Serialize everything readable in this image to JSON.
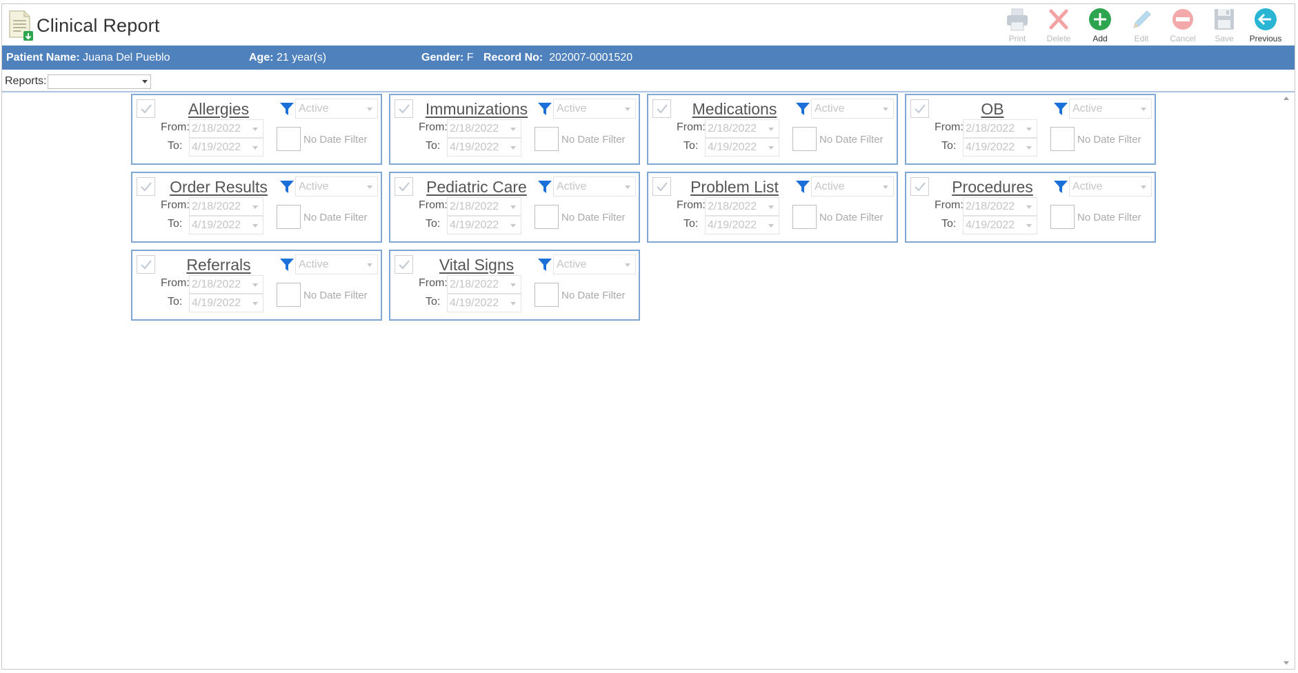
{
  "header": {
    "title": "Clinical Report",
    "toolbar": [
      {
        "key": "print",
        "label": "Print",
        "enabled": false,
        "icon": "printer-icon"
      },
      {
        "key": "delete",
        "label": "Delete",
        "enabled": false,
        "icon": "delete-x-icon"
      },
      {
        "key": "add",
        "label": "Add",
        "enabled": true,
        "icon": "add-plus-icon"
      },
      {
        "key": "edit",
        "label": "Edit",
        "enabled": false,
        "icon": "pencil-icon"
      },
      {
        "key": "cancel",
        "label": "Cancel",
        "enabled": false,
        "icon": "cancel-minus-icon"
      },
      {
        "key": "save",
        "label": "Save",
        "enabled": false,
        "icon": "floppy-icon"
      },
      {
        "key": "previous",
        "label": "Previous",
        "enabled": true,
        "icon": "back-arrow-icon"
      }
    ]
  },
  "patient": {
    "name_label": "Patient Name:",
    "name": "Juana Del Pueblo",
    "age_label": "Age:",
    "age": "21 year(s)",
    "gender_label": "Gender:",
    "gender": "F",
    "record_label": "Record No:",
    "record": "202007-0001520"
  },
  "reports": {
    "label": "Reports:",
    "value": ""
  },
  "card_labels": {
    "from": "From:",
    "to": "To:",
    "no_date_filter": "No Date Filter"
  },
  "cards": [
    {
      "title": "Allergies",
      "status": "Active",
      "from": "2/18/2022",
      "to": "4/19/2022",
      "checked": true
    },
    {
      "title": "Immunizations",
      "status": "Active",
      "from": "2/18/2022",
      "to": "4/19/2022",
      "checked": true
    },
    {
      "title": "Medications",
      "status": "Active",
      "from": "2/18/2022",
      "to": "4/19/2022",
      "checked": true
    },
    {
      "title": "OB",
      "status": "Active",
      "from": "2/18/2022",
      "to": "4/19/2022",
      "checked": true
    },
    {
      "title": "Order Results",
      "status": "Active",
      "from": "2/18/2022",
      "to": "4/19/2022",
      "checked": true
    },
    {
      "title": "Pediatric Care",
      "status": "Active",
      "from": "2/18/2022",
      "to": "4/19/2022",
      "checked": true
    },
    {
      "title": "Problem List",
      "status": "Active",
      "from": "2/18/2022",
      "to": "4/19/2022",
      "checked": true
    },
    {
      "title": "Procedures",
      "status": "Active",
      "from": "2/18/2022",
      "to": "4/19/2022",
      "checked": true
    },
    {
      "title": "Referrals",
      "status": "Active",
      "from": "2/18/2022",
      "to": "4/19/2022",
      "checked": true
    },
    {
      "title": "Vital Signs",
      "status": "Active",
      "from": "2/18/2022",
      "to": "4/19/2022",
      "checked": true
    }
  ],
  "colors": {
    "patient_bar": "#4f81bd",
    "card_border": "#7ea6d4",
    "filter_icon": "#1a6fd8",
    "add_green": "#2da44e",
    "previous_teal": "#2bb5d4"
  }
}
